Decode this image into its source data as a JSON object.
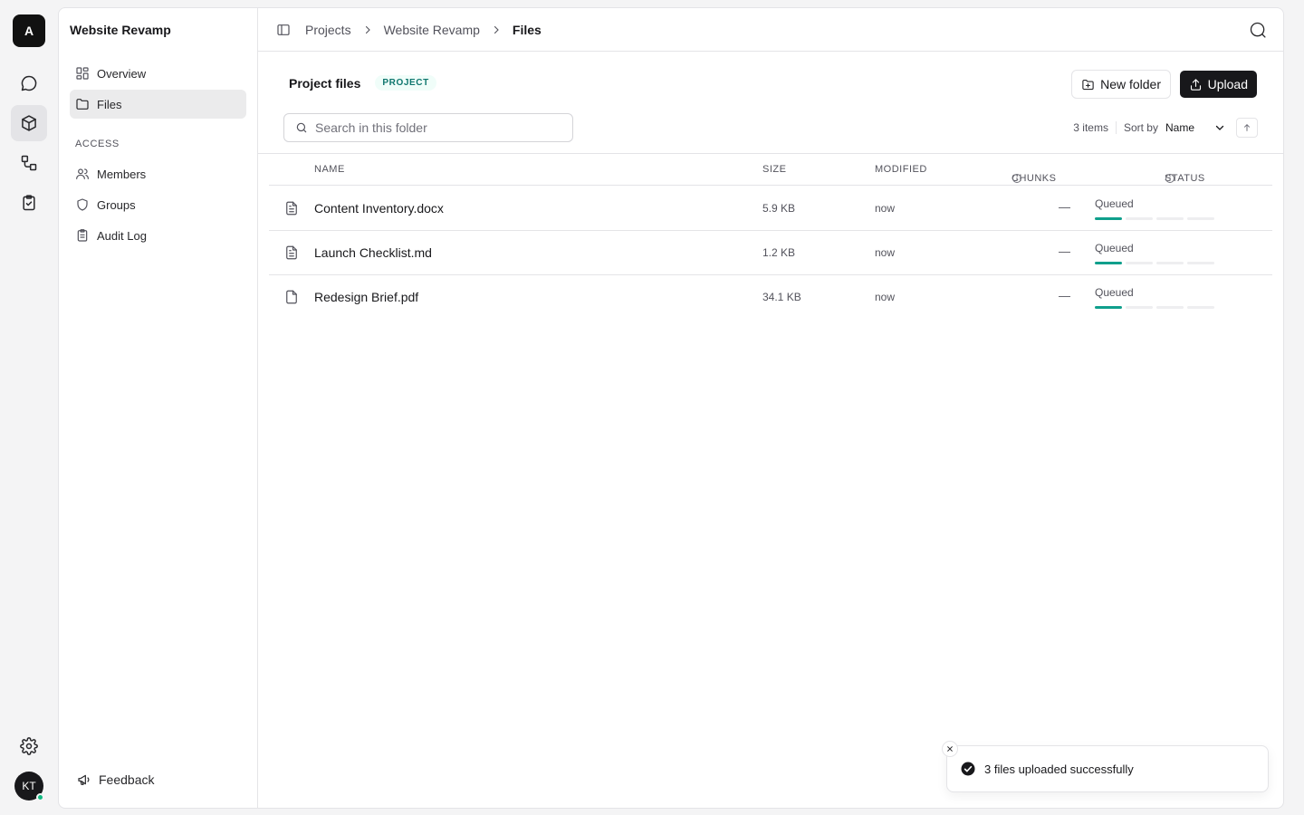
{
  "rail": {
    "logo_letter": "A",
    "icons": [
      "chat-icon",
      "box-icon",
      "workflow-icon",
      "clipboard-check-icon"
    ],
    "active_icon": "box-icon",
    "bottom_icons": [
      "gear-icon"
    ],
    "avatar_initials": "KT",
    "status_color": "#10b981"
  },
  "sidebar": {
    "title": "Website Revamp",
    "nav": [
      {
        "label": "Overview",
        "icon": "grid-icon"
      },
      {
        "label": "Files",
        "icon": "folder-icon",
        "active": true
      }
    ],
    "section_label": "ACCESS",
    "access": [
      {
        "label": "Members",
        "icon": "users-icon"
      },
      {
        "label": "Groups",
        "icon": "shield-icon"
      },
      {
        "label": "Audit Log",
        "icon": "clipboard-icon"
      }
    ],
    "feedback_label": "Feedback"
  },
  "topbar": {
    "breadcrumbs": [
      "Projects",
      "Website Revamp",
      "Files"
    ]
  },
  "header": {
    "title": "Project files",
    "badge": "PROJECT",
    "new_folder_label": "New folder",
    "upload_label": "Upload"
  },
  "search": {
    "placeholder": "Search in this folder"
  },
  "list_meta": {
    "count": "3 items",
    "sort_label": "Sort by",
    "sort_value": "Name"
  },
  "table": {
    "columns": [
      "NAME",
      "SIZE",
      "MODIFIED",
      "CHUNKS",
      "STATUS"
    ],
    "rows": [
      {
        "name": "Content Inventory.docx",
        "size": "5.9 KB",
        "modified": "now",
        "chunks": "—",
        "status": "Queued",
        "icon": "document-lines-icon"
      },
      {
        "name": "Launch Checklist.md",
        "size": "1.2 KB",
        "modified": "now",
        "chunks": "—",
        "status": "Queued",
        "icon": "document-lines-icon"
      },
      {
        "name": "Redesign Brief.pdf",
        "size": "34.1 KB",
        "modified": "now",
        "chunks": "—",
        "status": "Queued",
        "icon": "document-icon"
      }
    ],
    "progress_color": "#0f9f8c"
  },
  "toast": {
    "message": "3 files uploaded successfully"
  }
}
